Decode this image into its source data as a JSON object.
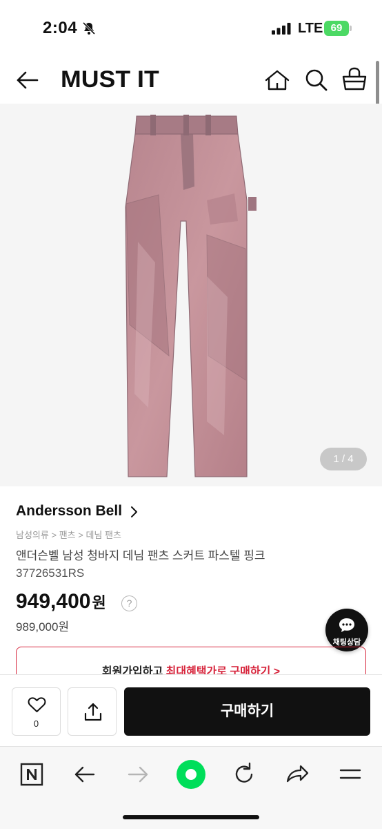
{
  "status_bar": {
    "time": "2:04",
    "network": "LTE",
    "battery": "69"
  },
  "header": {
    "logo": "MUST IT",
    "icons": [
      "back-arrow-icon",
      "home-icon",
      "search-icon",
      "basket-icon"
    ]
  },
  "gallery": {
    "counter": "1 / 4",
    "image_subject": "pink washed denim pants"
  },
  "product": {
    "brand": "Andersson Bell",
    "breadcrumb": [
      "남성의류",
      "팬츠",
      "데님 팬츠"
    ],
    "name": "앤더슨벨 남성 청바지 데님 팬츠 스커트 파스텔 핑크",
    "code": "37726531RS",
    "price": "949,400",
    "price_unit": "원",
    "help": "?",
    "original_price": "989,000원"
  },
  "chat": {
    "label": "채팅상담"
  },
  "signup_banner": {
    "text_plain": "회원가입하고 ",
    "text_highlight": "최대혜택가로 구매하기 >"
  },
  "purchase_bar": {
    "like_count": "0",
    "buy_label": "구매하기"
  },
  "browser_toolbar": {
    "icons": [
      "naver-n-icon",
      "back-icon",
      "forward-icon",
      "green-dot-icon",
      "reload-icon",
      "share-arrow-icon",
      "menu-icon"
    ]
  },
  "colors": {
    "accent_red": "#d7263d",
    "buy_button": "#111111",
    "battery_green": "#4cd964",
    "toolbar_green": "#00de5a"
  }
}
